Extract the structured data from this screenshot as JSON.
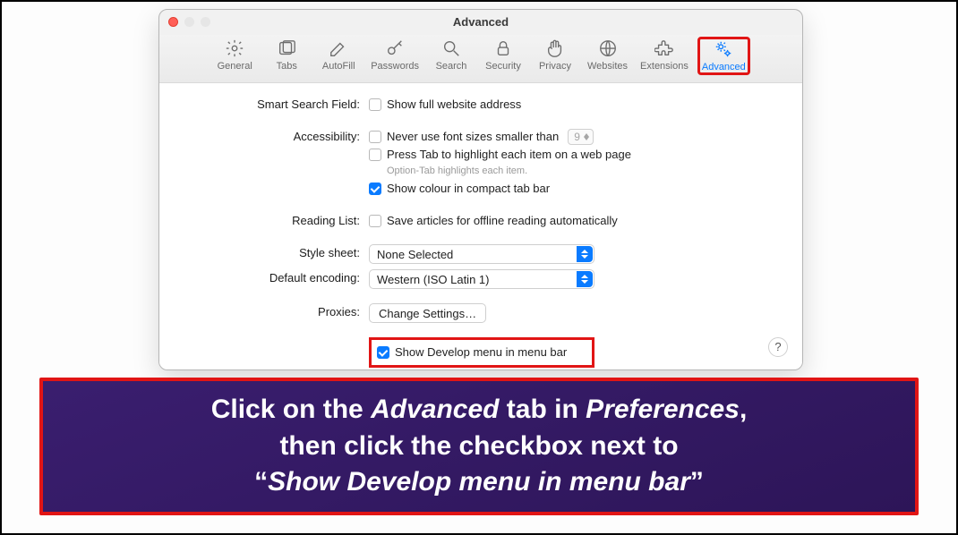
{
  "window": {
    "title": "Advanced"
  },
  "toolbar": [
    {
      "id": "general",
      "label": "General"
    },
    {
      "id": "tabs",
      "label": "Tabs"
    },
    {
      "id": "autofill",
      "label": "AutoFill"
    },
    {
      "id": "passwords",
      "label": "Passwords"
    },
    {
      "id": "search",
      "label": "Search"
    },
    {
      "id": "security",
      "label": "Security"
    },
    {
      "id": "privacy",
      "label": "Privacy"
    },
    {
      "id": "websites",
      "label": "Websites"
    },
    {
      "id": "extensions",
      "label": "Extensions"
    },
    {
      "id": "advanced",
      "label": "Advanced"
    }
  ],
  "labels": {
    "smart_search": "Smart Search Field:",
    "accessibility": "Accessibility:",
    "reading_list": "Reading List:",
    "style_sheet": "Style sheet:",
    "default_encoding": "Default encoding:",
    "proxies": "Proxies:"
  },
  "options": {
    "show_full_address": "Show full website address",
    "never_font_smaller": "Never use font sizes smaller than",
    "font_min_value": "9",
    "press_tab": "Press Tab to highlight each item on a web page",
    "option_tab_hint": "Option-Tab highlights each item.",
    "show_colour_tab": "Show colour in compact tab bar",
    "save_offline": "Save articles for offline reading automatically",
    "style_sheet_value": "None Selected",
    "encoding_value": "Western (ISO Latin 1)",
    "proxies_button": "Change Settings…",
    "show_develop": "Show Develop menu in menu bar"
  },
  "help": "?",
  "caption": {
    "part1": "Click on the ",
    "em1": "Advanced",
    "part2": " tab in ",
    "em2": "Preferences",
    "part3": ",",
    "line2a": "then click the checkbox next to",
    "quote_open": "“",
    "em3": "Show Develop menu in menu bar",
    "quote_close": "”"
  }
}
